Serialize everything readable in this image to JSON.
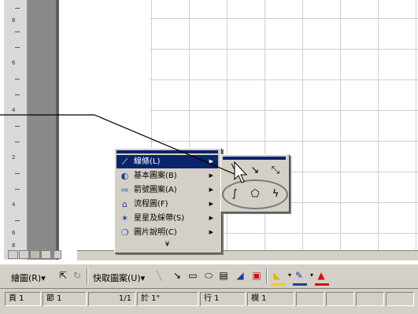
{
  "document": {
    "vertical_ruler_numbers": [
      "8",
      "6",
      "4",
      "2",
      "4",
      "6",
      "8"
    ]
  },
  "autoshape_menu": {
    "items": [
      {
        "label": "線條(L)",
        "icon": "line-icon",
        "selected": true,
        "has_submenu": true
      },
      {
        "label": "基本圖案(B)",
        "icon": "basic-shapes-icon",
        "selected": false,
        "has_submenu": true
      },
      {
        "label": "箭號圖案(A)",
        "icon": "block-arrows-icon",
        "selected": false,
        "has_submenu": true
      },
      {
        "label": "流程圖(F)",
        "icon": "flowchart-icon",
        "selected": false,
        "has_submenu": true
      },
      {
        "label": "星星及綵帶(S)",
        "icon": "stars-banners-icon",
        "selected": false,
        "has_submenu": true
      },
      {
        "label": "圖片說明(C)",
        "icon": "callouts-icon",
        "selected": false,
        "has_submenu": true
      }
    ],
    "more_indicator": "¥"
  },
  "lines_submenu": {
    "items": [
      {
        "name": "line-tool",
        "glyph": "╲"
      },
      {
        "name": "arrow-tool",
        "glyph": "↘"
      },
      {
        "name": "double-arrow-tool",
        "glyph": "⤡"
      },
      {
        "name": "curve-tool",
        "glyph": "∫"
      },
      {
        "name": "freeform-tool",
        "glyph": "⬠"
      },
      {
        "name": "scribble-tool",
        "glyph": "ϟ"
      }
    ]
  },
  "drawing_toolbar": {
    "draw_label": "繪圖(R)▾",
    "autoshapes_label": "快取圖案(U)▾",
    "select_icon": "select-objects-icon",
    "rotate_icon": "free-rotate-icon"
  },
  "status_bar": {
    "page": "頁 1",
    "section": "節 1",
    "page_count": "1/1",
    "position": "於 1\"",
    "line": "行 1",
    "column": "欄 1"
  },
  "colors": {
    "menu_highlight": "#0a246a",
    "chrome": "#d4d0c8",
    "fill_color_swatch": "#f0d000",
    "line_color_swatch": "#1a3da0",
    "font_color_swatch": "#d01010"
  }
}
